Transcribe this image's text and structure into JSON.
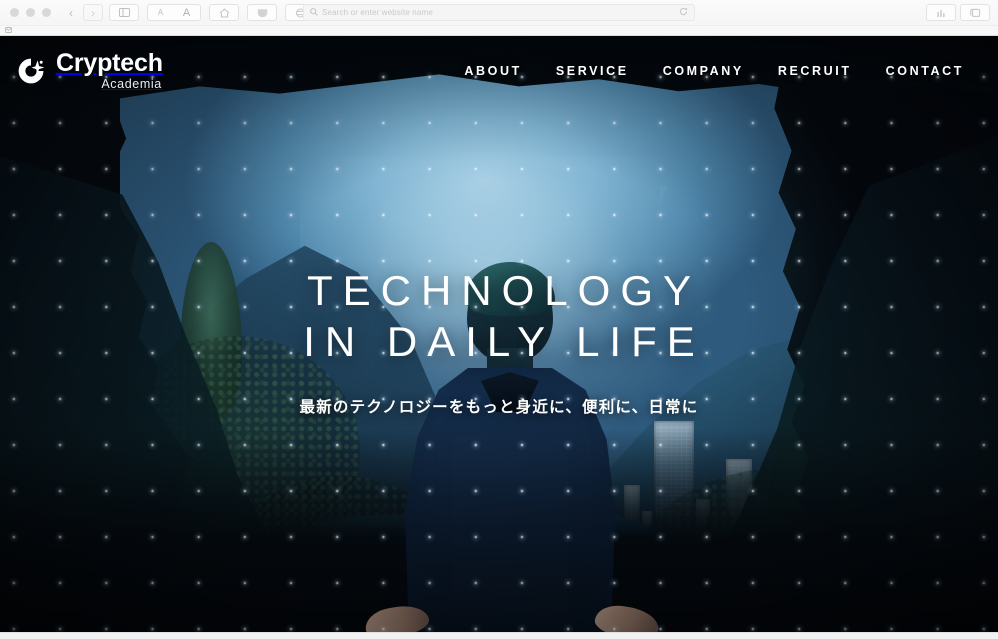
{
  "browser": {
    "traffic_lights": [
      "close",
      "minimize",
      "zoom"
    ],
    "back_label": "‹",
    "forward_label": "›",
    "sidebar_icon": "sidebar-icon",
    "font_small_label": "A",
    "font_large_label": "A",
    "home_icon": "home-icon",
    "shield_icon": "shield-icon",
    "extension_icon": "extension-icon",
    "privacy_icon": "privacy-report-icon",
    "address": {
      "placeholder": "Search or enter website name",
      "value": "",
      "search_icon": "search-icon",
      "reload_icon": "reload-icon"
    },
    "share_icon": "share-icon",
    "tabs_icon": "tab-overview-icon",
    "bookmark_icon": "bookmark-favicon"
  },
  "site": {
    "logo": {
      "mark": "cryptech-logo-mark",
      "name": "Cryptech",
      "sub": "Academia"
    },
    "nav": [
      {
        "label": "ABOUT"
      },
      {
        "label": "SERVICE"
      },
      {
        "label": "COMPANY"
      },
      {
        "label": "RECRUIT"
      },
      {
        "label": "CONTACT"
      }
    ],
    "hero": {
      "title_line1": "TECHNOLOGY",
      "title_line2": "IN DAILY LIFE",
      "subtitle": "最新のテクノロジーをもっと身近に、便利に、日常に"
    }
  },
  "colors": {
    "hero_dark": "#050a10",
    "sky_blue": "#7fb4d2",
    "lake_blue": "#1c6fa2",
    "text_white": "#ffffff",
    "chrome_bg": "#f3f3f3"
  }
}
